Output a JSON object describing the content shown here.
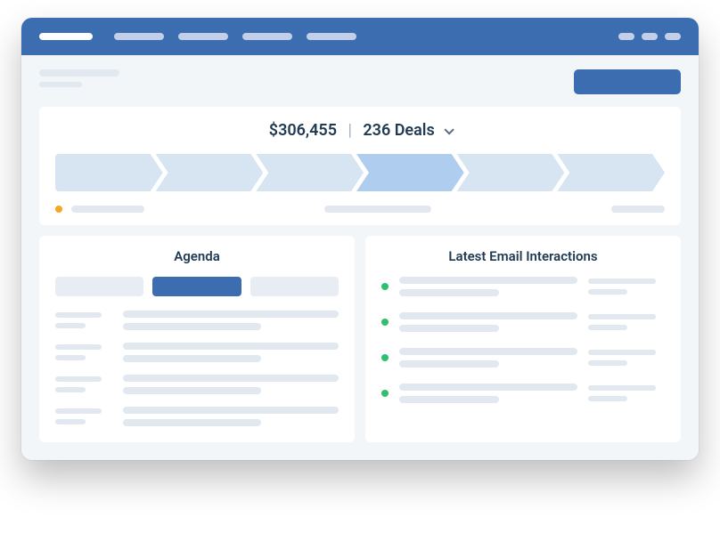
{
  "pipeline": {
    "total_value": "$306,455",
    "deal_count": "236 Deals",
    "stages": [
      {
        "active": false
      },
      {
        "active": false
      },
      {
        "active": false
      },
      {
        "active": true
      },
      {
        "active": false
      },
      {
        "active": false
      }
    ]
  },
  "panels": {
    "agenda": {
      "title": "Agenda"
    },
    "emails": {
      "title": "Latest Email Interactions"
    }
  },
  "colors": {
    "brand": "#3c6db0",
    "stage": "#d7e5f3",
    "stage_active": "#aecdef",
    "legend_dot": "#f5a623",
    "email_dot": "#2fbf71"
  }
}
